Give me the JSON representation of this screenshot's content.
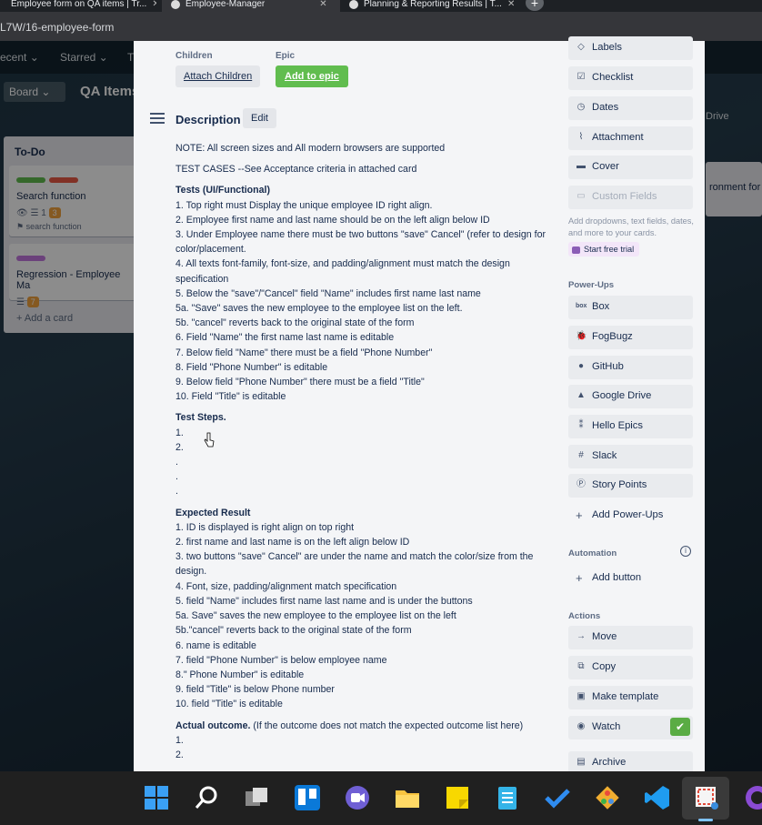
{
  "browser": {
    "tabs": [
      {
        "label": "Employee form on QA items | Tr..."
      },
      {
        "label": "Employee-Manager"
      },
      {
        "label": "Planning & Reporting Results | T..."
      }
    ],
    "new_tab_label": "+",
    "url_fragment": "L7W/16-employee-form"
  },
  "board": {
    "nav": {
      "recent": "ecent ⌄",
      "starred": "Starred ⌄",
      "more": "T"
    },
    "view_label": "Board ⌄",
    "title": "QA Items",
    "list": {
      "title": "To-Do",
      "cards": [
        {
          "title": "Search function",
          "meta": "☰ 1",
          "points": "3",
          "sub": "search function"
        },
        {
          "title": "Regression - Employee Ma",
          "points": "7"
        }
      ],
      "add_card": "+ Add a card"
    },
    "right_peek": "ronment for",
    "drive_peek": "Drive"
  },
  "card": {
    "children_label": "Children",
    "attach_children": "Attach Children",
    "epic_label": "Epic",
    "add_to_epic": "Add to epic",
    "description_title": "Description",
    "edit_label": "Edit",
    "description": {
      "note": "NOTE: All screen sizes and All modern browsers are supported",
      "test_cases": "TEST CASES --See Acceptance criteria in attached card",
      "tests_heading": "Tests (UI/Functional)",
      "tests": [
        "1. Top right must Display the unique employee ID right align.",
        "2. Employee first name and last name should be on the left align below ID",
        "3. Under Employee name there must be two buttons \"save\" Cancel\" (refer to design for color/placement.",
        "4. All texts font-family, font-size, and padding/alignment must match the design specification",
        "5. Below the \"save\"/\"Cancel\" field \"Name\" includes first name last name",
        "5a. \"Save\" saves the new employee to the employee list on the left.",
        "5b. \"cancel\" reverts back to the original state of the form",
        "6. Field \"Name\" the first name last name is editable",
        "7. Below field \"Name\" there must be a field \"Phone Number\"",
        "8. Field \"Phone Number\" is editable",
        "9. Below field \"Phone Number\" there must be a field \"Title\"",
        "10. Field \"Title\" is editable"
      ],
      "steps_heading": "Test Steps.",
      "steps": [
        "1.",
        "2.",
        ".",
        ".",
        "."
      ],
      "expected_heading": "Expected Result",
      "expected": [
        "1. ID is displayed is right align on top right",
        "2. first name and last name is on the left align below ID",
        "3. two buttons \"save\" Cancel\" are under the name and match the color/size from the design.",
        "4. Font, size, padding/alignment match specification",
        "5. field \"Name\" includes first name last name and is under the buttons",
        "5a. Save\" saves the new employee to the employee list on the left",
        "5b.\"cancel\" reverts back to the original state of the form",
        "6. name is editable",
        "7. field \"Phone Number\" is below employee name",
        "8.\" Phone Number\" is editable",
        "9. field \"Title\" is below Phone number",
        "10. field \"Title\" is editable"
      ],
      "actual_heading": "Actual outcome.",
      "actual_note": "(If the outcome does not match the expected outcome list here)",
      "actual": [
        "1.",
        "2."
      ]
    }
  },
  "sidebar": {
    "add_to_card": [
      {
        "label": "Labels",
        "icon": "label-icon"
      },
      {
        "label": "Checklist",
        "icon": "checklist-icon"
      },
      {
        "label": "Dates",
        "icon": "clock-icon"
      },
      {
        "label": "Attachment",
        "icon": "paperclip-icon"
      },
      {
        "label": "Cover",
        "icon": "cover-icon"
      },
      {
        "label": "Custom Fields",
        "icon": "custom-fields-icon"
      }
    ],
    "custom_fields_note": "Add dropdowns, text fields, dates, and more to your cards.",
    "start_trial": "Start free trial",
    "powerups_heading": "Power-Ups",
    "powerups": [
      {
        "label": "Box",
        "icon": "box-icon"
      },
      {
        "label": "FogBugz",
        "icon": "fogbugz-icon"
      },
      {
        "label": "GitHub",
        "icon": "github-icon"
      },
      {
        "label": "Google Drive",
        "icon": "google-drive-icon"
      },
      {
        "label": "Hello Epics",
        "icon": "hello-epics-icon"
      },
      {
        "label": "Slack",
        "icon": "slack-icon"
      },
      {
        "label": "Story Points",
        "icon": "story-points-icon"
      }
    ],
    "add_powerups": "Add Power-Ups",
    "automation_heading": "Automation",
    "add_button": "Add button",
    "actions_heading": "Actions",
    "actions": [
      {
        "label": "Move",
        "icon": "arrow-right-icon"
      },
      {
        "label": "Copy",
        "icon": "copy-icon"
      },
      {
        "label": "Make template",
        "icon": "template-icon"
      },
      {
        "label": "Watch",
        "icon": "eye-icon"
      },
      {
        "label": "Archive",
        "icon": "archive-icon"
      }
    ]
  },
  "taskbar": {
    "icons": [
      "windows-start-icon",
      "search-icon",
      "task-view-icon",
      "trello-icon",
      "teams-chat-icon",
      "file-explorer-icon",
      "sticky-notes-icon",
      "notepad-icon",
      "todo-icon",
      "git-icon",
      "vscode-icon",
      "snipping-tool-icon",
      "github-desktop-icon"
    ]
  },
  "colors": {
    "green": "#61bd4f",
    "label_green": "#61bd4f",
    "label_red": "#eb5a46",
    "label_purple": "#c377e0",
    "orange": "#f2a23c"
  }
}
